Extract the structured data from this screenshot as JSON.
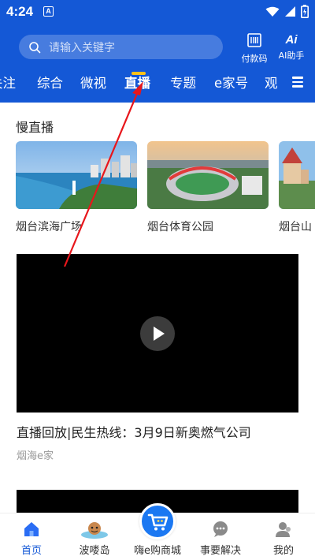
{
  "status_bar": {
    "time": "4:24",
    "app_indicator": "A"
  },
  "header": {
    "search_placeholder": "请输入关键字",
    "pay_code_label": "付款码",
    "ai_glyph": "Ai",
    "ai_label": "AI助手"
  },
  "tabs": [
    {
      "label": "关注",
      "active": false
    },
    {
      "label": "综合",
      "active": false
    },
    {
      "label": "微视",
      "active": false
    },
    {
      "label": "直播",
      "active": true
    },
    {
      "label": "专题",
      "active": false
    },
    {
      "label": "e家号",
      "active": false
    },
    {
      "label": "观",
      "active": false
    }
  ],
  "slow_live": {
    "title": "慢直播",
    "items": [
      {
        "caption": "烟台滨海广场"
      },
      {
        "caption": "烟台体育公园"
      },
      {
        "caption": "烟台山"
      }
    ]
  },
  "video": {
    "title": "直播回放|民生热线：3月9日新奥燃气公司",
    "source": "烟海e家"
  },
  "bottom_nav": [
    {
      "label": "首页",
      "icon": "home-icon",
      "active": true
    },
    {
      "label": "波喽岛",
      "icon": "island-icon",
      "active": false
    },
    {
      "label": "嗨e购商城",
      "icon": "shopping-cart-icon",
      "active": false
    },
    {
      "label": "事要解决",
      "icon": "chat-icon",
      "active": false
    },
    {
      "label": "我的",
      "icon": "user-icon",
      "active": false
    }
  ],
  "colors": {
    "brand_blue": "#1458d6",
    "tab_indicator": "#ffc21a",
    "annotation_arrow": "#e8161b"
  }
}
